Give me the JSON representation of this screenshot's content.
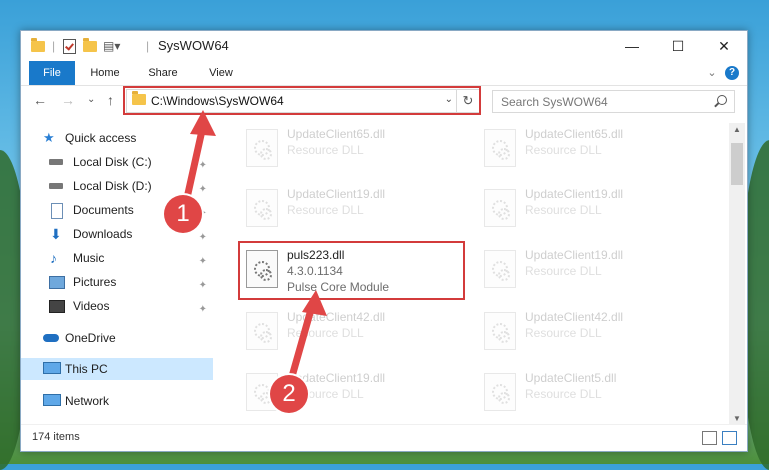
{
  "window": {
    "title": "SysWOW64",
    "controls": {
      "minimize": "—",
      "maximize": "☐",
      "close": "✕"
    }
  },
  "ribbon": {
    "tabs": [
      "File",
      "Home",
      "Share",
      "View"
    ],
    "collapse": "⌄",
    "help": "?"
  },
  "navigation": {
    "back": "←",
    "forward": "→",
    "recent": "⌄",
    "up": "↑",
    "address": "C:\\Windows\\SysWOW64",
    "address_chevron": "⌄",
    "refresh": "↻",
    "search_placeholder": "Search SysWOW64"
  },
  "nav_pane": {
    "items": [
      {
        "label": "Quick access",
        "icon": "star-icon",
        "pinned": false
      },
      {
        "label": "Local Disk (C:)",
        "icon": "drive-icon",
        "pinned": true
      },
      {
        "label": "Local Disk (D:)",
        "icon": "drive-icon",
        "pinned": true
      },
      {
        "label": "Documents",
        "icon": "documents-icon",
        "pinned": true
      },
      {
        "label": "Downloads",
        "icon": "downloads-icon",
        "pinned": true
      },
      {
        "label": "Music",
        "icon": "music-icon",
        "pinned": true
      },
      {
        "label": "Pictures",
        "icon": "pictures-icon",
        "pinned": true
      },
      {
        "label": "Videos",
        "icon": "videos-icon",
        "pinned": true
      },
      {
        "label": "OneDrive",
        "icon": "cloud-icon",
        "pinned": false
      },
      {
        "label": "This PC",
        "icon": "computer-icon",
        "pinned": false,
        "selected": true
      },
      {
        "label": "Network",
        "icon": "network-icon",
        "pinned": false
      }
    ],
    "pin_glyph": "📌"
  },
  "files": {
    "left": [
      {
        "name": "UpdateClient65.dll",
        "type": "Resource DLL"
      },
      {
        "name": "UpdateClient19.dll",
        "type": "Resource DLL"
      },
      {
        "name": "puls223.dll",
        "version": "4.3.0.1134",
        "description": "Pulse Core Module",
        "highlighted": true
      },
      {
        "name": "UpdateClient42.dll",
        "type": "Resource DLL"
      },
      {
        "name": "UpdateClient19.dll",
        "type": "Resource DLL"
      }
    ],
    "right": [
      {
        "name": "UpdateClient65.dll",
        "type": "Resource DLL"
      },
      {
        "name": "UpdateClient19.dll",
        "type": "Resource DLL"
      },
      {
        "name": "UpdateClient19.dll",
        "type": "Resource DLL"
      },
      {
        "name": "UpdateClient42.dll",
        "type": "Resource DLL"
      },
      {
        "name": "UpdateClient5.dll",
        "type": "Resource DLL"
      }
    ]
  },
  "status": {
    "count": "174 items"
  },
  "callouts": [
    "1",
    "2"
  ],
  "colors": {
    "accent": "#1979ca",
    "highlight": "#d33b3b",
    "selected": "#cce8ff"
  }
}
